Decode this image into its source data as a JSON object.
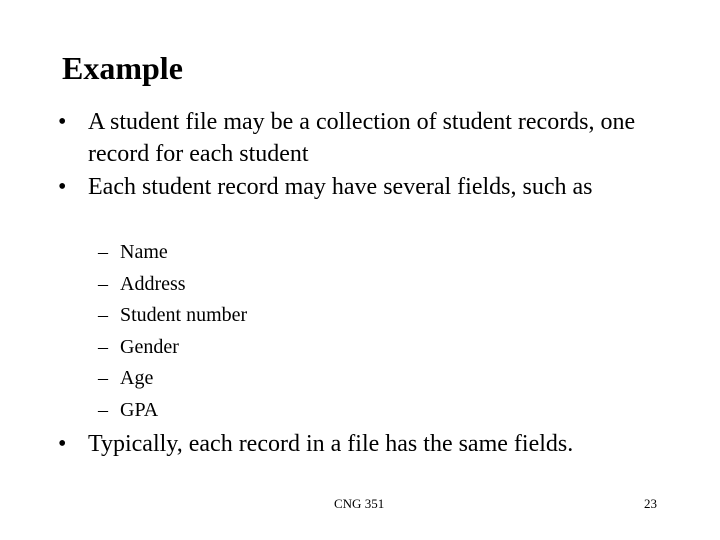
{
  "slide": {
    "title": "Example",
    "bullets": [
      {
        "marker": "•",
        "text": "A student file may be a collection of student records, one record for each student"
      },
      {
        "marker": "•",
        "text": "Each student record may have several fields, such as"
      },
      {
        "marker": "•",
        "text": "Typically, each record in a file has the same fields."
      }
    ],
    "sub_marker": "–",
    "fields": [
      "Name",
      "Address",
      "Student number",
      "Gender",
      "Age",
      "GPA"
    ],
    "footer": {
      "course": "CNG 351",
      "page_number": "23"
    }
  }
}
